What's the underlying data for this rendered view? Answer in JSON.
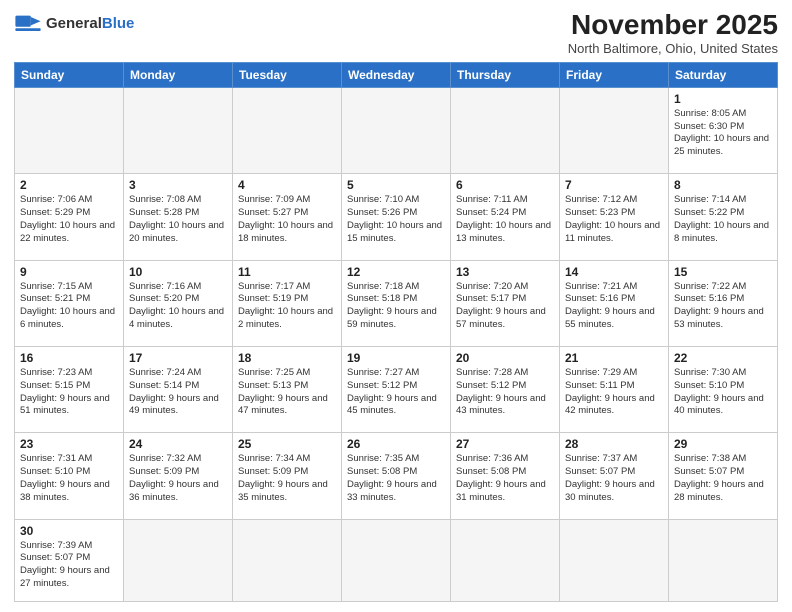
{
  "header": {
    "logo_general": "General",
    "logo_blue": "Blue",
    "month": "November 2025",
    "location": "North Baltimore, Ohio, United States"
  },
  "weekdays": [
    "Sunday",
    "Monday",
    "Tuesday",
    "Wednesday",
    "Thursday",
    "Friday",
    "Saturday"
  ],
  "weeks": [
    [
      {
        "day": "",
        "info": "",
        "empty": true
      },
      {
        "day": "",
        "info": "",
        "empty": true
      },
      {
        "day": "",
        "info": "",
        "empty": true
      },
      {
        "day": "",
        "info": "",
        "empty": true
      },
      {
        "day": "",
        "info": "",
        "empty": true
      },
      {
        "day": "",
        "info": "",
        "empty": true
      },
      {
        "day": "1",
        "info": "Sunrise: 8:05 AM\nSunset: 6:30 PM\nDaylight: 10 hours\nand 25 minutes.",
        "empty": false
      }
    ],
    [
      {
        "day": "2",
        "info": "Sunrise: 7:06 AM\nSunset: 5:29 PM\nDaylight: 10 hours\nand 22 minutes.",
        "empty": false
      },
      {
        "day": "3",
        "info": "Sunrise: 7:08 AM\nSunset: 5:28 PM\nDaylight: 10 hours\nand 20 minutes.",
        "empty": false
      },
      {
        "day": "4",
        "info": "Sunrise: 7:09 AM\nSunset: 5:27 PM\nDaylight: 10 hours\nand 18 minutes.",
        "empty": false
      },
      {
        "day": "5",
        "info": "Sunrise: 7:10 AM\nSunset: 5:26 PM\nDaylight: 10 hours\nand 15 minutes.",
        "empty": false
      },
      {
        "day": "6",
        "info": "Sunrise: 7:11 AM\nSunset: 5:24 PM\nDaylight: 10 hours\nand 13 minutes.",
        "empty": false
      },
      {
        "day": "7",
        "info": "Sunrise: 7:12 AM\nSunset: 5:23 PM\nDaylight: 10 hours\nand 11 minutes.",
        "empty": false
      },
      {
        "day": "8",
        "info": "Sunrise: 7:14 AM\nSunset: 5:22 PM\nDaylight: 10 hours\nand 8 minutes.",
        "empty": false
      }
    ],
    [
      {
        "day": "9",
        "info": "Sunrise: 7:15 AM\nSunset: 5:21 PM\nDaylight: 10 hours\nand 6 minutes.",
        "empty": false
      },
      {
        "day": "10",
        "info": "Sunrise: 7:16 AM\nSunset: 5:20 PM\nDaylight: 10 hours\nand 4 minutes.",
        "empty": false
      },
      {
        "day": "11",
        "info": "Sunrise: 7:17 AM\nSunset: 5:19 PM\nDaylight: 10 hours\nand 2 minutes.",
        "empty": false
      },
      {
        "day": "12",
        "info": "Sunrise: 7:18 AM\nSunset: 5:18 PM\nDaylight: 9 hours\nand 59 minutes.",
        "empty": false
      },
      {
        "day": "13",
        "info": "Sunrise: 7:20 AM\nSunset: 5:17 PM\nDaylight: 9 hours\nand 57 minutes.",
        "empty": false
      },
      {
        "day": "14",
        "info": "Sunrise: 7:21 AM\nSunset: 5:16 PM\nDaylight: 9 hours\nand 55 minutes.",
        "empty": false
      },
      {
        "day": "15",
        "info": "Sunrise: 7:22 AM\nSunset: 5:16 PM\nDaylight: 9 hours\nand 53 minutes.",
        "empty": false
      }
    ],
    [
      {
        "day": "16",
        "info": "Sunrise: 7:23 AM\nSunset: 5:15 PM\nDaylight: 9 hours\nand 51 minutes.",
        "empty": false
      },
      {
        "day": "17",
        "info": "Sunrise: 7:24 AM\nSunset: 5:14 PM\nDaylight: 9 hours\nand 49 minutes.",
        "empty": false
      },
      {
        "day": "18",
        "info": "Sunrise: 7:25 AM\nSunset: 5:13 PM\nDaylight: 9 hours\nand 47 minutes.",
        "empty": false
      },
      {
        "day": "19",
        "info": "Sunrise: 7:27 AM\nSunset: 5:12 PM\nDaylight: 9 hours\nand 45 minutes.",
        "empty": false
      },
      {
        "day": "20",
        "info": "Sunrise: 7:28 AM\nSunset: 5:12 PM\nDaylight: 9 hours\nand 43 minutes.",
        "empty": false
      },
      {
        "day": "21",
        "info": "Sunrise: 7:29 AM\nSunset: 5:11 PM\nDaylight: 9 hours\nand 42 minutes.",
        "empty": false
      },
      {
        "day": "22",
        "info": "Sunrise: 7:30 AM\nSunset: 5:10 PM\nDaylight: 9 hours\nand 40 minutes.",
        "empty": false
      }
    ],
    [
      {
        "day": "23",
        "info": "Sunrise: 7:31 AM\nSunset: 5:10 PM\nDaylight: 9 hours\nand 38 minutes.",
        "empty": false
      },
      {
        "day": "24",
        "info": "Sunrise: 7:32 AM\nSunset: 5:09 PM\nDaylight: 9 hours\nand 36 minutes.",
        "empty": false
      },
      {
        "day": "25",
        "info": "Sunrise: 7:34 AM\nSunset: 5:09 PM\nDaylight: 9 hours\nand 35 minutes.",
        "empty": false
      },
      {
        "day": "26",
        "info": "Sunrise: 7:35 AM\nSunset: 5:08 PM\nDaylight: 9 hours\nand 33 minutes.",
        "empty": false
      },
      {
        "day": "27",
        "info": "Sunrise: 7:36 AM\nSunset: 5:08 PM\nDaylight: 9 hours\nand 31 minutes.",
        "empty": false
      },
      {
        "day": "28",
        "info": "Sunrise: 7:37 AM\nSunset: 5:07 PM\nDaylight: 9 hours\nand 30 minutes.",
        "empty": false
      },
      {
        "day": "29",
        "info": "Sunrise: 7:38 AM\nSunset: 5:07 PM\nDaylight: 9 hours\nand 28 minutes.",
        "empty": false
      }
    ],
    [
      {
        "day": "30",
        "info": "Sunrise: 7:39 AM\nSunset: 5:07 PM\nDaylight: 9 hours\nand 27 minutes.",
        "empty": false
      },
      {
        "day": "",
        "info": "",
        "empty": true
      },
      {
        "day": "",
        "info": "",
        "empty": true
      },
      {
        "day": "",
        "info": "",
        "empty": true
      },
      {
        "day": "",
        "info": "",
        "empty": true
      },
      {
        "day": "",
        "info": "",
        "empty": true
      },
      {
        "day": "",
        "info": "",
        "empty": true
      }
    ]
  ]
}
